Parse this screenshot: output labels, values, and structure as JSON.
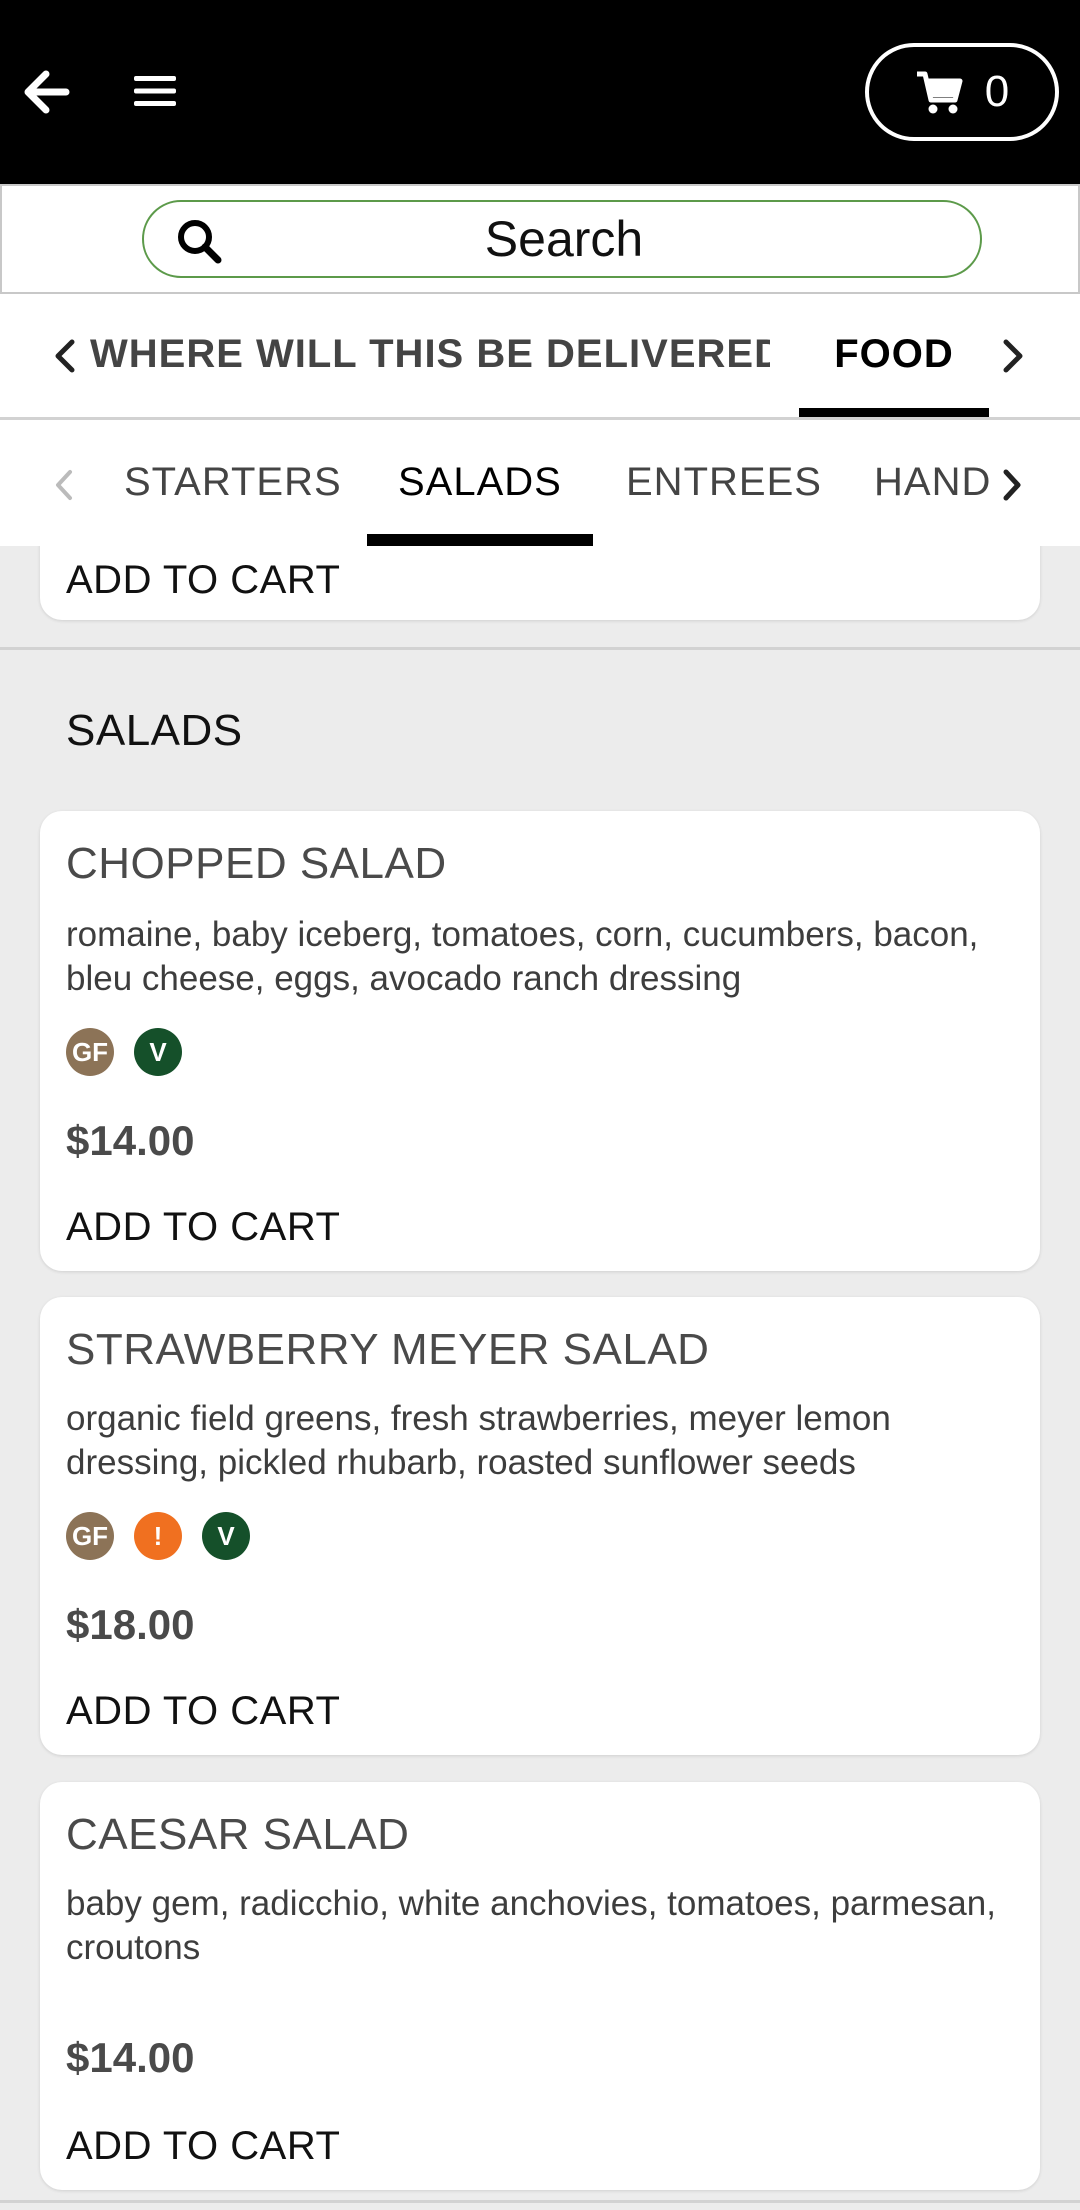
{
  "header": {
    "back_icon": "back-arrow-icon",
    "menu_icon": "hamburger-menu-icon",
    "cart_icon": "shopping-cart-icon",
    "cart_count": "0",
    "bg_color": "#000000"
  },
  "search": {
    "placeholder": "Search",
    "border_color": "#5c9a4a"
  },
  "primary_tabs": {
    "items": [
      {
        "label": "WHERE WILL THIS BE DELIVERED?",
        "active": false
      },
      {
        "label": "FOOD",
        "active": true
      }
    ]
  },
  "category_tabs": {
    "items": [
      {
        "label": "STARTERS",
        "active": false
      },
      {
        "label": "SALADS",
        "active": true
      },
      {
        "label": "ENTREES",
        "active": false
      },
      {
        "label": "HAND",
        "active": false
      }
    ]
  },
  "previous_card": {
    "add_label": "ADD TO CART"
  },
  "section": {
    "title": "SALADS"
  },
  "items": [
    {
      "name": "CHOPPED SALAD",
      "description": "romaine, baby iceberg, tomatoes, corn, cucumbers, bacon, bleu cheese, eggs, avocado ranch dressing",
      "badges": [
        "GF",
        "V"
      ],
      "price": "$14.00",
      "add_label": "ADD TO CART"
    },
    {
      "name": "STRAWBERRY MEYER SALAD",
      "description": "organic field greens, fresh strawberries, meyer lemon dressing, pickled rhubarb, roasted sunflower seeds",
      "badges": [
        "GF",
        "!",
        "V"
      ],
      "price": "$18.00",
      "add_label": "ADD TO CART"
    },
    {
      "name": "CAESAR SALAD",
      "description": "baby gem, radicchio, white anchovies, tomatoes, parmesan, croutons",
      "badges": [],
      "price": "$14.00",
      "add_label": "ADD TO CART"
    }
  ],
  "colors": {
    "gf_badge": "#8c7357",
    "vegetarian_badge": "#15502a",
    "allergen_badge": "#f07020",
    "page_bg": "#ececec"
  }
}
